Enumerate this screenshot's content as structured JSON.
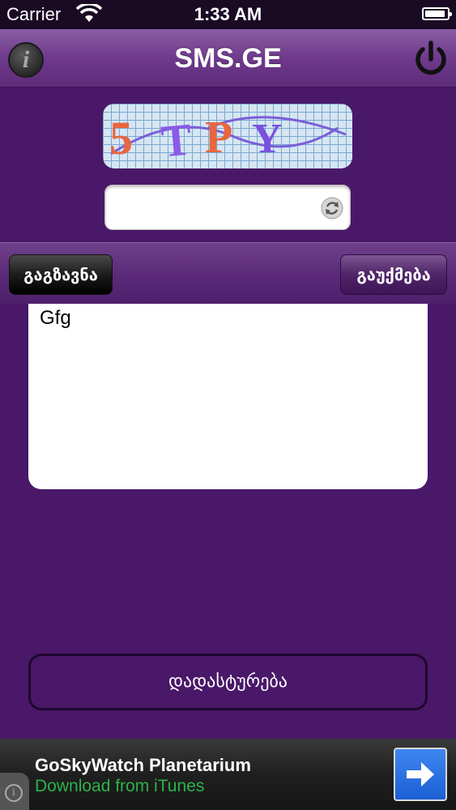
{
  "status_bar": {
    "carrier": "Carrier",
    "time": "1:33 AM"
  },
  "nav": {
    "title": "SMS.GE",
    "info_icon": "info-icon",
    "power_icon": "power-icon"
  },
  "captcha": {
    "text": "5TPY",
    "input_value": "",
    "refresh_icon": "refresh-icon"
  },
  "toolbar": {
    "send_label": "გაგზავნა",
    "cancel_label": "გაუქმება"
  },
  "message": {
    "text": "Gfg"
  },
  "confirm": {
    "label": "დადასტურება"
  },
  "ad": {
    "title": "GoSkyWatch Planetarium",
    "subtitle": "Download from iTunes",
    "arrow_icon": "arrow-right-icon",
    "info_icon": "info-icon"
  },
  "colors": {
    "background": "#4a1868",
    "nav": "#6f3a8c",
    "ad_link": "#2bb34a",
    "ad_button": "#2a6fe0"
  }
}
